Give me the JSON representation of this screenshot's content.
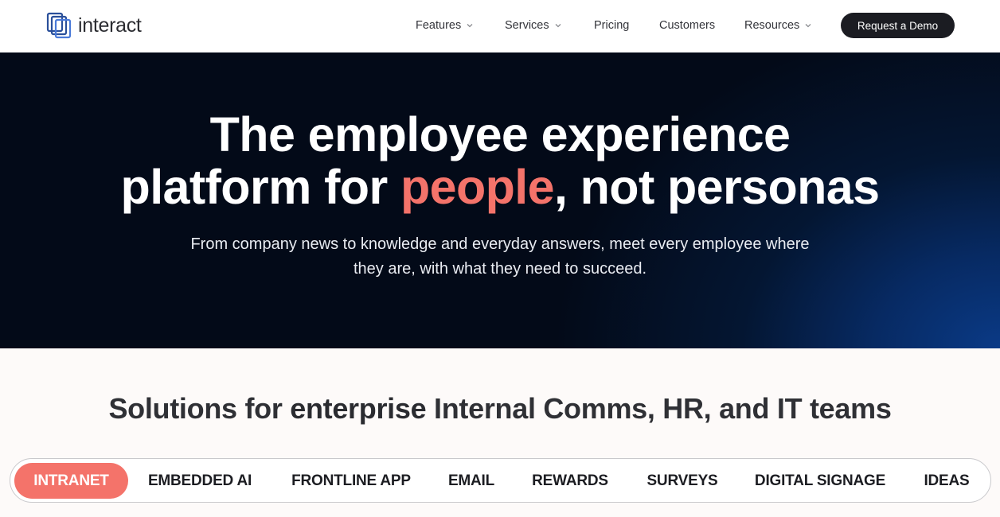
{
  "header": {
    "logo_text": "interact",
    "nav": [
      {
        "label": "Features",
        "has_dropdown": true
      },
      {
        "label": "Services",
        "has_dropdown": true
      },
      {
        "label": "Pricing",
        "has_dropdown": false
      },
      {
        "label": "Customers",
        "has_dropdown": false
      },
      {
        "label": "Resources",
        "has_dropdown": true
      }
    ],
    "cta_label": "Request a Demo"
  },
  "hero": {
    "title_line1": "The employee experience",
    "title_line2_pre": "platform for ",
    "title_accent": "people",
    "title_line2_post": ", not personas",
    "subtitle_line1": "From company news to knowledge and everyday answers, meet every employee where",
    "subtitle_line2": "they are, with what they need to succeed."
  },
  "solutions": {
    "title_pre": "Solutions for ",
    "title_bold": "enterprise",
    "title_post": " Internal Comms, HR, and IT teams",
    "tabs": [
      "INTRANET",
      "EMBEDDED AI",
      "FRONTLINE APP",
      "EMAIL",
      "REWARDS",
      "SURVEYS",
      "DIGITAL SIGNAGE",
      "IDEAS"
    ],
    "active_tab": "INTRANET"
  },
  "colors": {
    "accent": "#f4736a",
    "dark": "#1b1c22",
    "hero_bg": "#030a18",
    "hero_glow": "#0a3a86"
  }
}
